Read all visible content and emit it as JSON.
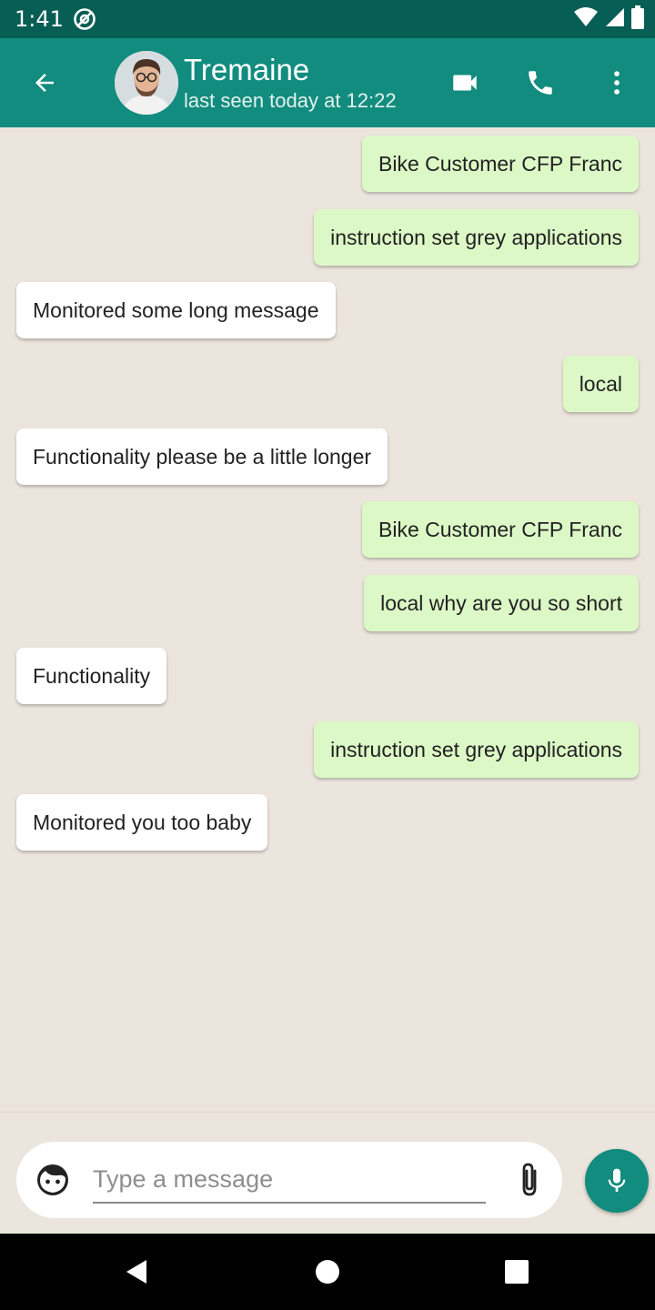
{
  "status_bar": {
    "time": "1:41",
    "icons": [
      "at-sign-icon",
      "wifi-icon",
      "cellular-signal-icon",
      "battery-icon"
    ]
  },
  "header": {
    "contact_name": "Tremaine",
    "last_seen": "last seen today at 12:22",
    "actions": [
      "back-arrow-icon",
      "video-call-icon",
      "phone-icon",
      "more-vert-icon"
    ],
    "color": "#128c7e",
    "status_color": "#075e54"
  },
  "messages": [
    {
      "text": "Bike Customer CFP Franc",
      "type": "sent"
    },
    {
      "text": "instruction set grey applications",
      "type": "sent"
    },
    {
      "text": "Monitored some long message",
      "type": "received"
    },
    {
      "text": "local",
      "type": "sent"
    },
    {
      "text": "Functionality please be a little longer",
      "type": "received"
    },
    {
      "text": "Bike Customer CFP Franc",
      "type": "sent"
    },
    {
      "text": "local why are you so short",
      "type": "sent"
    },
    {
      "text": "Functionality",
      "type": "received"
    },
    {
      "text": "instruction set grey applications",
      "type": "sent"
    },
    {
      "text": "Monitored you too baby",
      "type": "received"
    }
  ],
  "composer": {
    "placeholder": "Type a message",
    "value": "",
    "icons": [
      "emoji-icon",
      "attachment-icon",
      "mic-icon"
    ]
  },
  "colors": {
    "sent_bubble": "#dcf8c6",
    "received_bubble": "#ffffff",
    "chat_background": "#ece5dd"
  },
  "nav_bar": {
    "icons": [
      "back-triangle-icon",
      "home-circle-icon",
      "recents-square-icon"
    ]
  }
}
